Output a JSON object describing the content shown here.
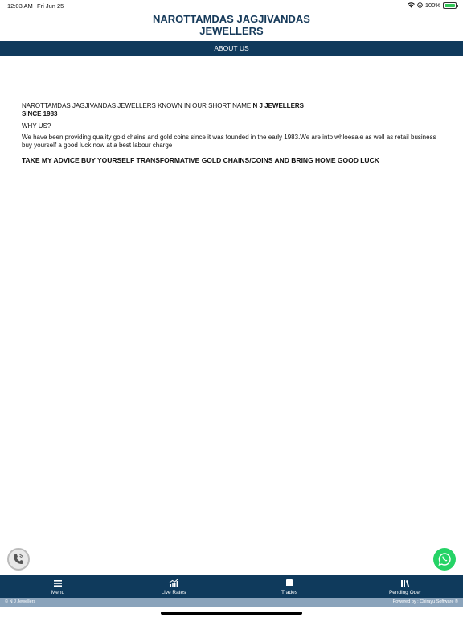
{
  "status_bar": {
    "time": "12:03 AM",
    "date": "Fri Jun 25",
    "battery_percent": "100%"
  },
  "app": {
    "title_line1": "NAROTTAMDAS JAGJIVANDAS",
    "title_line2": "JEWELLERS"
  },
  "page": {
    "header": "ABOUT US",
    "intro_prefix": "NAROTTAMDAS JAGJIVANDAS JEWELLERS KNOWN IN OUR SHORT NAME ",
    "intro_bold": "N J JEWELLERS",
    "since": "SINCE 1983",
    "why": "WHY US?",
    "paragraph": "We have been providing quality gold chains and gold coins since it was founded in the early 1983.We are into whloesale as well as retail business buy yourself a good luck now at a best labour charge",
    "advice": "TAKE MY ADVICE BUY YOURSELF TRANSFORMATIVE GOLD CHAINS/COINS AND BRING HOME GOOD LUCK"
  },
  "bottom_nav": {
    "items": [
      {
        "label": "Menu",
        "icon": "menu-icon"
      },
      {
        "label": "Live Rates",
        "icon": "chart-icon"
      },
      {
        "label": "Trades",
        "icon": "book-icon"
      },
      {
        "label": "Pending Oder",
        "icon": "library-icon"
      }
    ]
  },
  "footer": {
    "left": "© N J Jewellers",
    "right": "Powered by : Chirayu Software ®"
  },
  "colors": {
    "primary": "#103a5c",
    "footer": "#8aa3bb",
    "whatsapp": "#25d366",
    "battery": "#34c759"
  }
}
